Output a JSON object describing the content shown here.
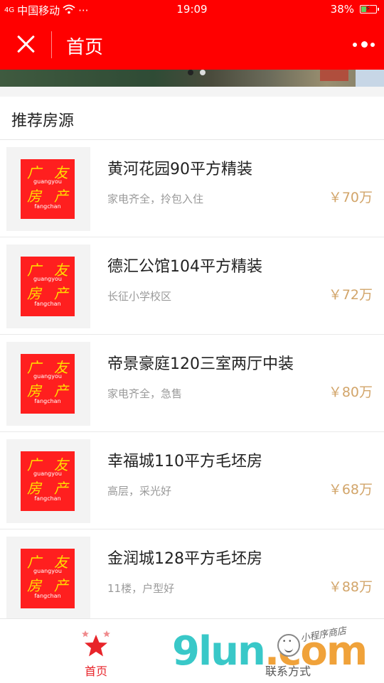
{
  "status_bar": {
    "signal": "4G",
    "carrier": "中国移动",
    "time": "19:09",
    "battery": "38%",
    "battery_level": 0.38
  },
  "title_bar": {
    "title": "首页"
  },
  "section": {
    "title": "推荐房源"
  },
  "logo": {
    "top_chars": [
      "广",
      "友"
    ],
    "top_pinyin": "guangyou",
    "bottom_chars": [
      "房",
      "产"
    ],
    "bottom_pinyin": "fangchan"
  },
  "listings": [
    {
      "title": "黄河花园90平方精装",
      "desc": "家电齐全，拎包入住",
      "price": "￥70万"
    },
    {
      "title": "德汇公馆104平方精装",
      "desc": "长征小学校区",
      "price": "￥72万"
    },
    {
      "title": "帝景豪庭120三室两厅中装",
      "desc": "家电齐全，急售",
      "price": "￥80万"
    },
    {
      "title": "幸福城110平方毛坯房",
      "desc": "高层，采光好",
      "price": "￥68万"
    },
    {
      "title": "金润城128平方毛坯房",
      "desc": "11楼，户型好",
      "price": "￥88万"
    }
  ],
  "tab_bar": {
    "home": "首页",
    "contact": "联系方式"
  },
  "watermark": {
    "main": "9lun",
    "suffix": ".com",
    "sub": "小程序商店"
  },
  "colors": {
    "brand_red": "#ff0000",
    "price": "#d2a56a",
    "active_tab": "#e8242a"
  }
}
